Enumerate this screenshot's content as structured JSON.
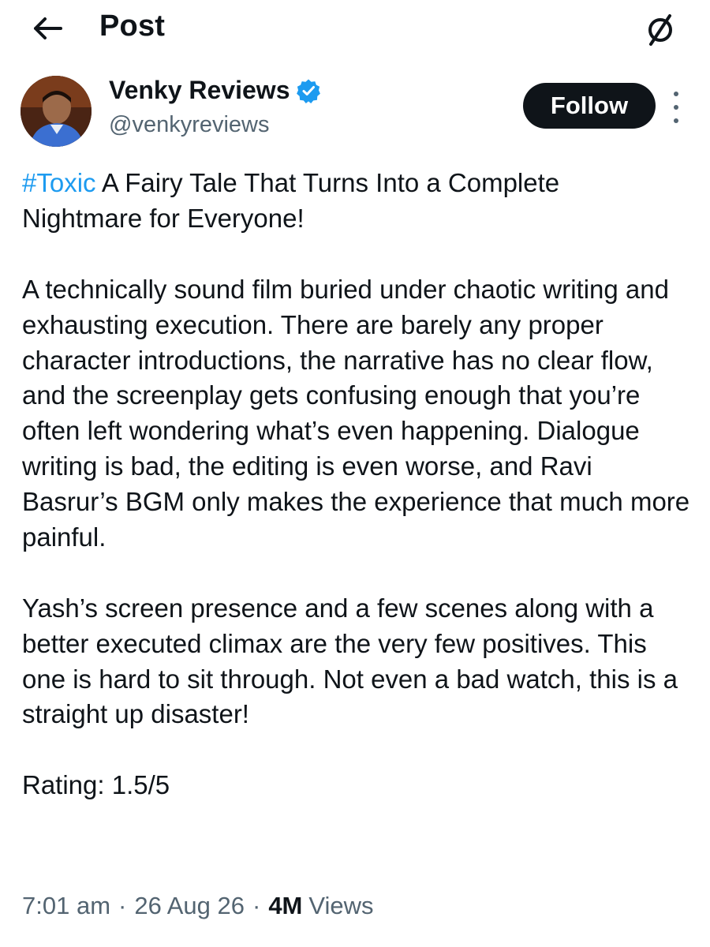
{
  "header": {
    "title": "Post",
    "back_icon": "arrow-left-icon",
    "grok_icon": "slashed-circle-icon"
  },
  "author": {
    "display_name": "Venky Reviews",
    "handle": "@venkyreviews",
    "verified": true,
    "verified_color": "#1d9bf0",
    "avatar_icon": "profile-photo"
  },
  "actions": {
    "follow_label": "Follow",
    "more_icon": "vertical-dots-icon"
  },
  "post": {
    "hashtag": "#Toxic",
    "headline": " A Fairy Tale That Turns Into a Complete Nightmare for Everyone!",
    "paragraph_1": "A technically sound film buried under chaotic writing and exhausting execution. There are barely any proper character introductions, the narrative has no clear flow, and the screenplay gets confusing enough that you’re often left wondering what’s even happening. Dialogue writing is bad, the editing is even worse, and Ravi Basrur’s BGM only makes the experience that much more painful.",
    "paragraph_2": "Yash’s screen presence and a few scenes along with a better executed climax are the very few positives. This one is hard to sit through. Not even a bad watch, this is a straight up disaster!",
    "rating": "Rating: 1.5/5"
  },
  "meta": {
    "time": "7:01 am",
    "date": "26 Aug 26",
    "separator": "·",
    "views_count": "4M",
    "views_label": "Views"
  },
  "colors": {
    "text": "#0f1419",
    "secondary": "#536471",
    "link": "#1d9bf0",
    "button_bg": "#0f1419"
  }
}
